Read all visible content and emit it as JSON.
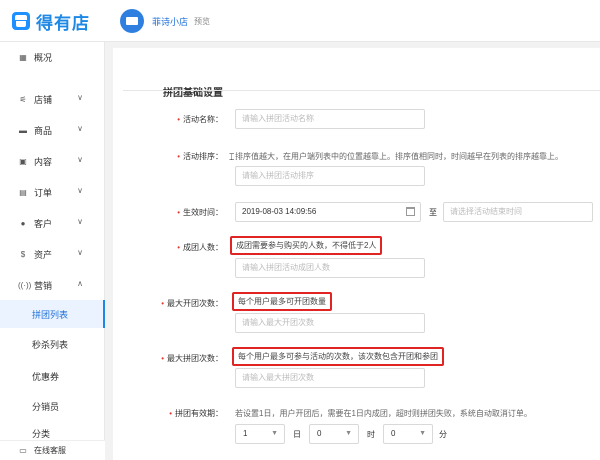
{
  "header": {
    "logo_text": "得有店",
    "shop_name": "菲诗小店",
    "preview_label": "预览"
  },
  "sidebar": {
    "items": [
      {
        "label": "概况",
        "icon": "grid-icon"
      },
      {
        "label": "店铺",
        "icon": "sliders-icon"
      },
      {
        "label": "商品",
        "icon": "box-icon"
      },
      {
        "label": "内容",
        "icon": "document-icon"
      },
      {
        "label": "订单",
        "icon": "list-icon"
      },
      {
        "label": "客户",
        "icon": "user-icon"
      },
      {
        "label": "资产",
        "icon": "dollar-icon"
      },
      {
        "label": "营销",
        "icon": "broadcast-icon"
      }
    ],
    "sub_items": [
      "拼团列表",
      "秒杀列表",
      "优惠券",
      "分销员",
      "分类"
    ],
    "service_label": "在线客服"
  },
  "form": {
    "section_title": "拼团基础设置",
    "activity_name": {
      "label": "活动名称：",
      "placeholder": "请输入拼团活动名称"
    },
    "activity_sort": {
      "label": "活动排序：",
      "hint": "排序值越大，在用户端列表中的位置越靠上。排序值相同时，时间越早在列表的排序越靠上。",
      "placeholder": "请输入拼团活动排序"
    },
    "effective_time": {
      "label": "生效时间：",
      "start_value": "2019-08-03 14:09:56",
      "separator": "至",
      "end_placeholder": "请选择活动结束时间"
    },
    "group_size": {
      "label": "成团人数：",
      "hint": "成团需要参与购买的人数，不得低于2人",
      "placeholder": "请输入拼团活动成团人数"
    },
    "max_open": {
      "label": "最大开团次数：",
      "hint": "每个用户最多可开团数量",
      "placeholder": "请输入最大开团次数"
    },
    "max_join": {
      "label": "最大拼团次数：",
      "hint": "每个用户最多可参与活动的次数，该次数包含开团和参团",
      "placeholder": "请输入最大拼团次数"
    },
    "validity": {
      "label": "拼团有效期：",
      "hint": "若设置1日，用户开团后，需要在1日内成团，超时则拼团失败，系统自动取消订单。",
      "day_value": "1",
      "day_unit": "日",
      "hour_value": "0",
      "hour_unit": "时",
      "minute_value": "0",
      "minute_unit": "分"
    }
  },
  "colors": {
    "accent": "#1e88e5",
    "required": "#e53935",
    "highlight_border": "#e02424"
  }
}
